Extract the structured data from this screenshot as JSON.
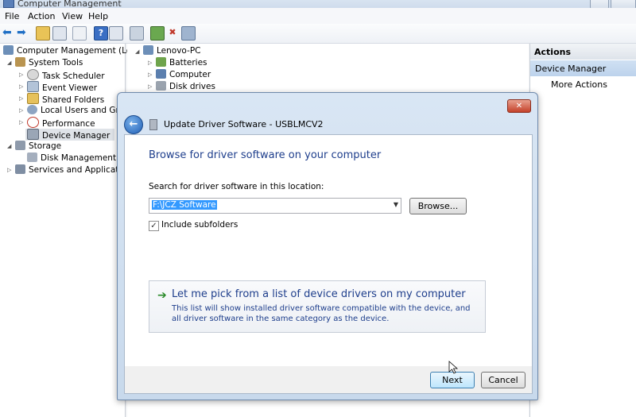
{
  "window": {
    "title": "Computer Management"
  },
  "menu": [
    "File",
    "Action",
    "View",
    "Help"
  ],
  "tree": {
    "root": "Computer Management (Local",
    "items": [
      {
        "label": "System Tools",
        "level": 1,
        "icon": "tools-icon"
      },
      {
        "label": "Task Scheduler",
        "level": 2,
        "icon": "clock-icon"
      },
      {
        "label": "Event Viewer",
        "level": 2,
        "icon": "event-viewer-icon"
      },
      {
        "label": "Shared Folders",
        "level": 2,
        "icon": "folder-icon"
      },
      {
        "label": "Local Users and Group",
        "level": 2,
        "icon": "users-icon"
      },
      {
        "label": "Performance",
        "level": 2,
        "icon": "performance-icon"
      },
      {
        "label": "Device Manager",
        "level": 2,
        "icon": "device-manager-icon"
      },
      {
        "label": "Storage",
        "level": 1,
        "icon": "storage-icon"
      },
      {
        "label": "Disk Management",
        "level": 2,
        "icon": "disk-icon"
      },
      {
        "label": "Services and Applications",
        "level": 1,
        "icon": "services-icon"
      }
    ]
  },
  "devices": {
    "root": "Lenovo-PC",
    "items": [
      "Batteries",
      "Computer",
      "Disk drives"
    ]
  },
  "actions": {
    "header": "Actions",
    "section": "Device Manager",
    "more": "More Actions"
  },
  "dialog": {
    "title": "Update Driver Software - USBLMCV2",
    "heading": "Browse for driver software on your computer",
    "search_label": "Search for driver software in this location:",
    "path_value": "F:\\JCZ Software",
    "browse_label": "Browse...",
    "include_label": "Include subfolders",
    "include_checked": true,
    "pick_title": "Let me pick from a list of device drivers on my computer",
    "pick_desc": "This list will show installed driver software compatible with the device, and all driver software in the same category as the device.",
    "next_label": "Next",
    "cancel_label": "Cancel",
    "close_glyph": "✕"
  },
  "colors": {
    "accent_blue": "#1e3e8c",
    "selection": "#3399ff",
    "dialog_frame": "#c8d9ec"
  }
}
